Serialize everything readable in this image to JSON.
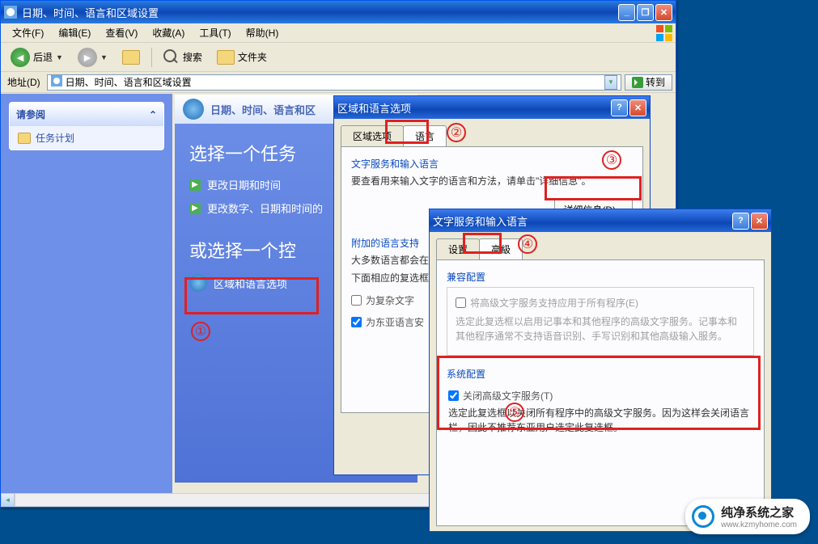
{
  "explorer": {
    "title": "日期、时间、语言和区域设置",
    "menus": {
      "file": "文件(F)",
      "edit": "编辑(E)",
      "view": "查看(V)",
      "fav": "收藏(A)",
      "tools": "工具(T)",
      "help": "帮助(H)"
    },
    "toolbar": {
      "back": "后退",
      "search": "搜索",
      "folders": "文件夹"
    },
    "address_label": "地址(D)",
    "address_value": "日期、时间、语言和区域设置",
    "go": "转到",
    "sidebar_title": "请参阅",
    "sidebar_item": "任务计划"
  },
  "bluetask": {
    "header": "日期、时间、语言和区",
    "h1": "选择一个任务",
    "link1": "更改日期和时间",
    "link2": "更改数字、日期和时间的",
    "h2": "或选择一个控",
    "icon_label": "区域和语言选项"
  },
  "dlg1": {
    "title": "区域和语言选项",
    "tab1": "区域选项",
    "tab2": "语言",
    "sect1": "文字服务和输入语言",
    "p1": "要查看用来输入文字的语言和方法，请单击\"详细信息\"。",
    "btn_detail": "详细信息(D)...",
    "sect2": "附加的语言支持",
    "p2a": "大多数语言都会在",
    "p2b": "下面相应的复选框",
    "cb1": "为复杂文字",
    "cb2": "为东亚语言安"
  },
  "dlg2": {
    "title": "文字服务和输入语言",
    "tab1": "设置",
    "tab2": "高級",
    "sect1": "兼容配置",
    "cb1": "将高级文字服务支持应用于所有程序(E)",
    "p1": "选定此复选框以启用记事本和其他程序的高级文字服务。记事本和其他程序通常不支持语音识别、手写识别和其他高级输入服务。",
    "sect2": "系统配置",
    "cb2": "关闭高级文字服务(T)",
    "p2": "选定此复选框以关闭所有程序中的高级文字服务。因为这样会关闭语言栏，因此不推荐东亚用户选定此复选框。"
  },
  "annotations": {
    "n1": "①",
    "n2": "②",
    "n3": "③",
    "n4": "④",
    "n5": "⑤"
  },
  "watermark": {
    "title": "纯净系统之家",
    "url": "www.kzmyhome.com"
  }
}
